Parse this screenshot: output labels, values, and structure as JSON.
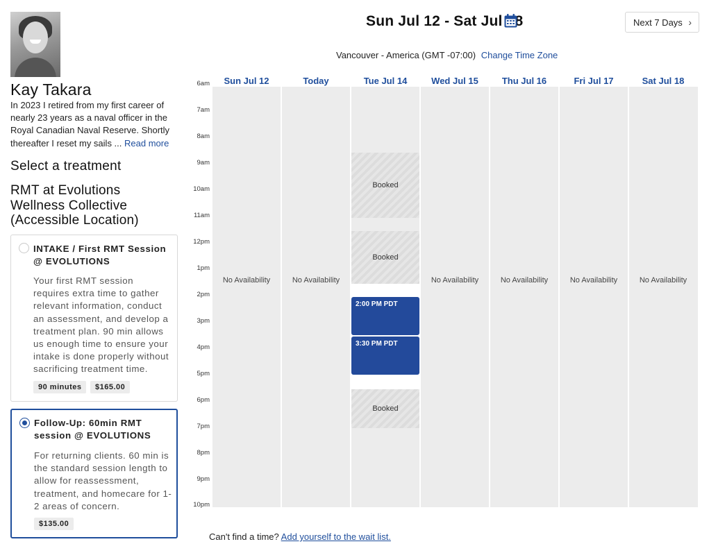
{
  "profile": {
    "name": "Kay Takara",
    "bio_text": "In 2023 I retired from my first career of nearly 23 years as a naval officer in the Royal Canadian Naval Reserve. Shortly thereafter I reset my sails ...",
    "read_more": "Read more"
  },
  "treatment": {
    "heading": "Select a treatment",
    "location": "RMT at Evolutions Wellness Collective (Accessible Location)",
    "options": [
      {
        "title": "INTAKE / First RMT Session @ EVOLUTIONS",
        "description": "Your first RMT session requires extra time to gather relevant information, conduct an assessment, and develop a treatment plan. 90 min allows us enough time to ensure your intake is done properly without sacrificing treatment time.",
        "duration": "90 minutes",
        "price": "$165.00",
        "selected": false
      },
      {
        "title": "Follow-Up: 60min RMT session @ EVOLUTIONS",
        "description": "For returning clients. 60 min is the standard session length to allow for reassessment, treatment, and homecare for 1-2 areas of concern.",
        "price": "$135.00",
        "selected": true
      }
    ]
  },
  "header": {
    "range": "Sun Jul 12 - Sat Jul 18",
    "next_label": "Next 7 Days",
    "timezone": "Vancouver - America (GMT -07:00)",
    "change_tz": "Change Time Zone"
  },
  "calendar": {
    "days": [
      "Sun Jul 12",
      "Today",
      "Tue Jul 14",
      "Wed Jul 15",
      "Thu Jul 16",
      "Fri Jul 17",
      "Sat Jul 18"
    ],
    "hours": [
      "6am",
      "7am",
      "8am",
      "9am",
      "10am",
      "11am",
      "12pm",
      "1pm",
      "2pm",
      "3pm",
      "4pm",
      "5pm",
      "6pm",
      "7pm",
      "8pm",
      "9pm",
      "10pm"
    ],
    "no_availability": "No Availability",
    "booked_label": "Booked",
    "slots": [
      "2:00 PM PDT",
      "3:30 PM PDT"
    ]
  },
  "footer": {
    "prompt": "Can't find a time?",
    "link": "Add yourself to the wait list."
  },
  "colors": {
    "accent": "#1f4e9c",
    "slot": "#234a9b",
    "column_bg": "#ececec"
  }
}
